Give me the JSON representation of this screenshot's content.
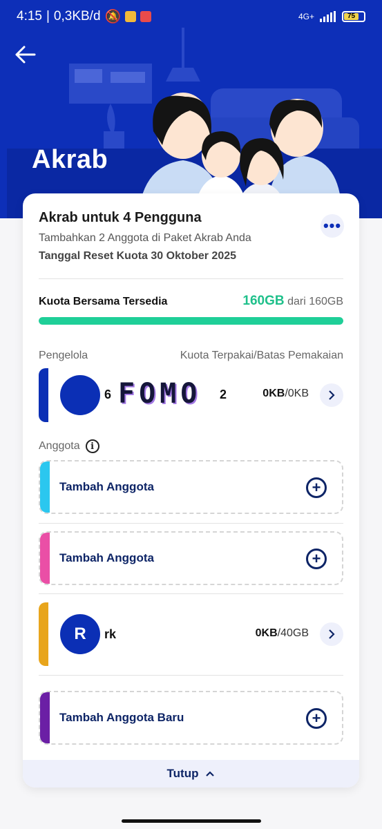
{
  "status_bar": {
    "time": "4:15",
    "speed": "0,3KB/d",
    "network": "4G+",
    "battery": "75"
  },
  "hero": {
    "title": "Akrab"
  },
  "card": {
    "plan_title": "Akrab untuk 4 Pengguna",
    "plan_subtitle": "Tambahkan 2 Anggota di Paket Akrab Anda",
    "reset_date": "Tanggal Reset Kuota 30 Oktober 2025",
    "quota_label": "Kuota Bersama Tersedia",
    "quota_available": "160GB",
    "quota_total": "dari 160GB",
    "quota_fraction": 1.0,
    "manager_header": "Pengelola",
    "usage_header": "Kuota Terpakai/Batas Pemakaian",
    "manager": {
      "name_prefix": "6",
      "name_suffix": "2",
      "watermark": "FOMO",
      "usage_used": "0KB",
      "usage_limit": "/0KB",
      "bar_color": "#0b2fb5"
    },
    "members_header": "Anggota",
    "slots": [
      {
        "label": "Tambah Anggota",
        "bar_color": "#2bc7ef"
      },
      {
        "label": "Tambah Anggota",
        "bar_color": "#ea4fa6"
      }
    ],
    "member": {
      "initial": "R",
      "name": "rk",
      "usage_used": "0KB",
      "usage_limit": "/40GB",
      "bar_color": "#e8a51c"
    },
    "new_slot": {
      "label": "Tambah Anggota Baru",
      "bar_color": "#6b1fa5"
    },
    "footer_label": "Tutup"
  }
}
